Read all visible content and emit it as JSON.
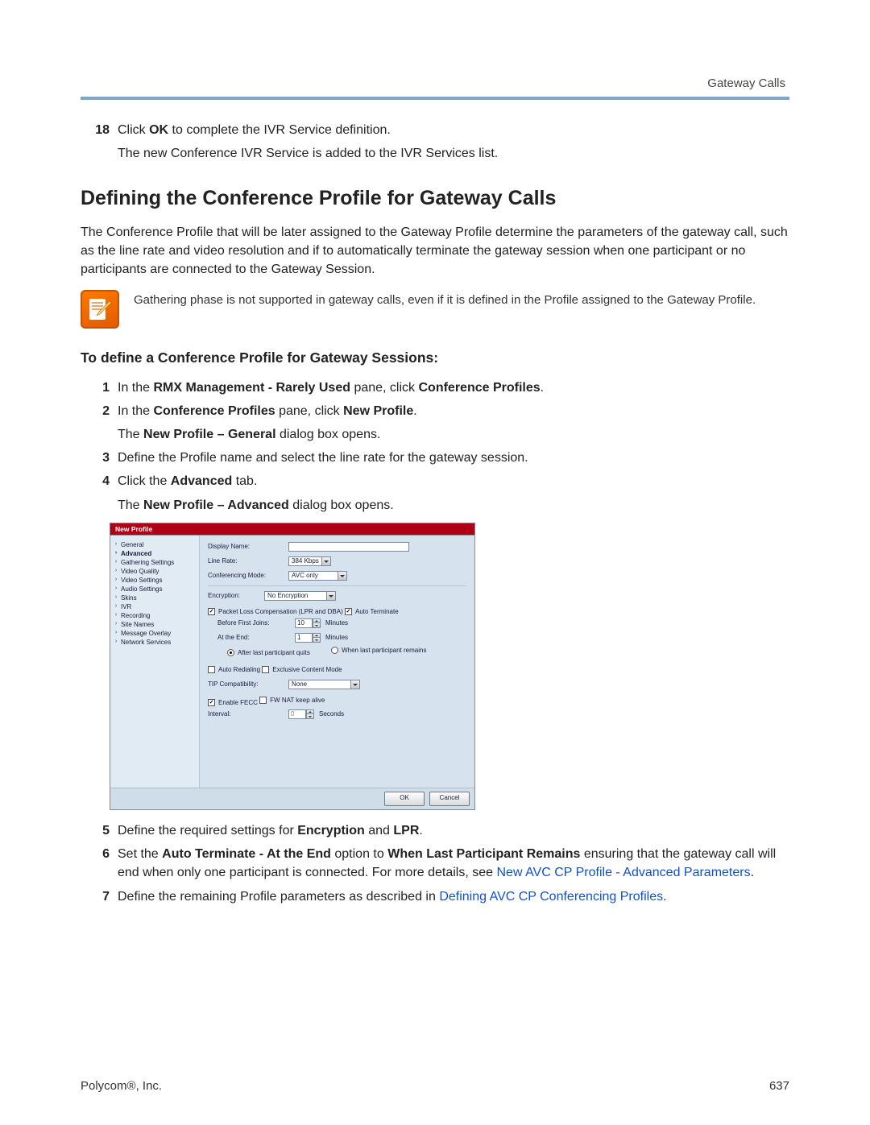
{
  "header": {
    "section": "Gateway Calls"
  },
  "intro": {
    "step18Num": "18",
    "step18Part1": "Click ",
    "step18Bold": "OK",
    "step18Part2": " to complete the IVR Service definition.",
    "step18Sub": "The new Conference IVR Service is added to the IVR Services list."
  },
  "sectionHeading": "Defining the Conference Profile for Gateway Calls",
  "sectionBody": "The Conference Profile that will be later assigned to the Gateway Profile determine the parameters of the gateway call, such as the line rate and video resolution and if to automatically terminate the gateway session when one participant or no participants are connected to the Gateway Session.",
  "noteText": "Gathering phase is not supported in gateway calls, even if it is defined in the Profile assigned to the Gateway Profile.",
  "subHeading": "To define a Conference Profile for Gateway Sessions:",
  "steps": {
    "s1": {
      "n": "1",
      "p1": "In the ",
      "b1": "RMX Management - Rarely Used",
      "p2": " pane, click ",
      "b2": "Conference Profiles",
      "p3": "."
    },
    "s2": {
      "n": "2",
      "p1": "In the ",
      "b1": "Conference Profiles",
      "p2": " pane, click ",
      "b2": "New Profile",
      "p3": ".",
      "subP1": "The ",
      "subB": "New Profile – General",
      "subP2": " dialog box opens."
    },
    "s3": {
      "n": "3",
      "t": "Define the Profile name and select the line rate for the gateway session."
    },
    "s4": {
      "n": "4",
      "p1": "Click the ",
      "b1": "Advanced",
      "p2": " tab.",
      "subP1": "The ",
      "subB": "New Profile – Advanced",
      "subP2": " dialog box opens."
    },
    "s5": {
      "n": "5",
      "p1": "Define the required settings for ",
      "b1": "Encryption",
      "p2": " and ",
      "b2": "LPR",
      "p3": "."
    },
    "s6": {
      "n": "6",
      "p1": "Set the ",
      "b1": "Auto Terminate - At the End",
      "p2": " option to ",
      "b2": "When Last Participant Remains",
      "p3": " ensuring that the gateway call will end when only one participant is connected. For more details, see ",
      "link": "New AVC CP Profile - Advanced Parameters",
      "p4": "."
    },
    "s7": {
      "n": "7",
      "p1": "Define the remaining Profile parameters as described in ",
      "link": "Defining AVC CP Conferencing Profiles",
      "p2": "."
    }
  },
  "dialog": {
    "title": "New Profile",
    "nav": {
      "general": "General",
      "advanced": "Advanced",
      "gathering": "Gathering Settings",
      "vq": "Video Quality",
      "vs": "Video Settings",
      "as": "Audio Settings",
      "skins": "Skins",
      "ivr": "IVR",
      "rec": "Recording",
      "sn": "Site Names",
      "mo": "Message Overlay",
      "ns": "Network Services"
    },
    "labels": {
      "displayName": "Display Name:",
      "lineRate": "Line Rate:",
      "confMode": "Conferencing Mode:",
      "encryption": "Encryption:",
      "pktLoss": "Packet Loss Compensation (LPR and DBA)",
      "autoTerm": "Auto Terminate",
      "beforeFirst": "Before First Joins:",
      "atEnd": "At the End:",
      "afterLastQuits": "After last participant quits",
      "whenLastRemains": "When last participant remains",
      "autoRedial": "Auto Redialing",
      "exclusiveContent": "Exclusive Content Mode",
      "tipCompat": "TIP Compatibility:",
      "enableFecc": "Enable FECC",
      "fwNat": "FW NAT keep alive",
      "interval": "Interval:",
      "minutes": "Minutes",
      "seconds": "Seconds"
    },
    "values": {
      "displayName": "",
      "lineRate": "384 Kbps",
      "confMode": "AVC only",
      "encryption": "No Encryption",
      "beforeFirst": "10",
      "atEnd": "1",
      "tipCompat": "None",
      "interval": "0"
    },
    "checks": {
      "pktLoss": true,
      "autoTerm": true,
      "afterLastQuits": true,
      "whenLastRemains": false,
      "autoRedial": false,
      "exclusiveContent": false,
      "enableFecc": true,
      "fwNat": false
    },
    "buttons": {
      "ok": "OK",
      "cancel": "Cancel"
    }
  },
  "footer": {
    "left": "Polycom®, Inc.",
    "right": "637"
  }
}
